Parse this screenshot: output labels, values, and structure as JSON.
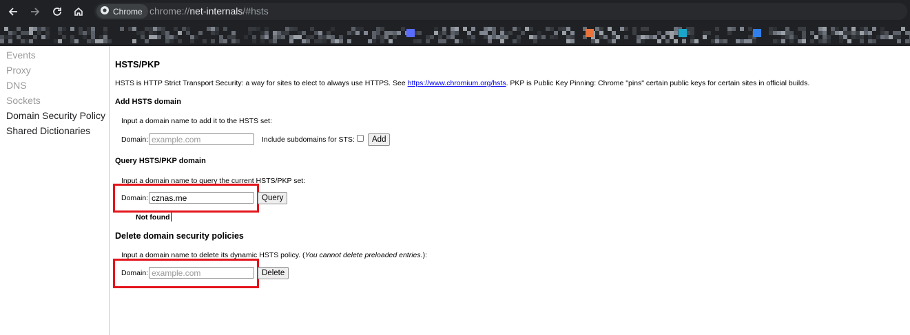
{
  "browser": {
    "chip_label": "Chrome",
    "url_scheme": "chrome://",
    "url_host": "net-internals",
    "url_path": "/#hsts",
    "icons": [
      "back-arrow-icon",
      "forward-arrow-icon",
      "reload-icon",
      "home-icon",
      "chrome-logo-icon"
    ]
  },
  "sidebar": {
    "items": [
      {
        "label": "Events"
      },
      {
        "label": "Proxy"
      },
      {
        "label": "DNS"
      },
      {
        "label": "Sockets"
      },
      {
        "label": "Domain Security Policy"
      },
      {
        "label": "Shared Dictionaries"
      }
    ]
  },
  "main": {
    "title": "HSTS/PKP",
    "description_before_link": "HSTS is HTTP Strict Transport Security: a way for sites to elect to always use HTTPS. See ",
    "description_link": "https://www.chromium.org/hsts",
    "description_after_link": ". PKP is Public Key Pinning: Chrome \"pins\" certain public keys for certain sites in official builds.",
    "add": {
      "heading": "Add HSTS domain",
      "instruction": "Input a domain name to add it to the HSTS set:",
      "domain_label": "Domain:",
      "placeholder": "example.com",
      "subdomains_label": "Include subdomains for STS:",
      "button": "Add"
    },
    "query": {
      "heading": "Query HSTS/PKP domain",
      "instruction": "Input a domain name to query the current HSTS/PKP set:",
      "domain_label": "Domain:",
      "value": "cznas.me",
      "button": "Query",
      "result": "Not found"
    },
    "delete": {
      "heading": "Delete domain security policies",
      "instruction_before": "Input a domain name to delete its dynamic HSTS policy. (",
      "instruction_italic": "You cannot delete preloaded entries.",
      "instruction_after": "):",
      "domain_label": "Domain:",
      "placeholder": "example.com",
      "button": "Delete"
    }
  },
  "colors": {
    "highlight": "#e4141b",
    "link": "#0000ee",
    "chrome_dark": "#202124"
  }
}
